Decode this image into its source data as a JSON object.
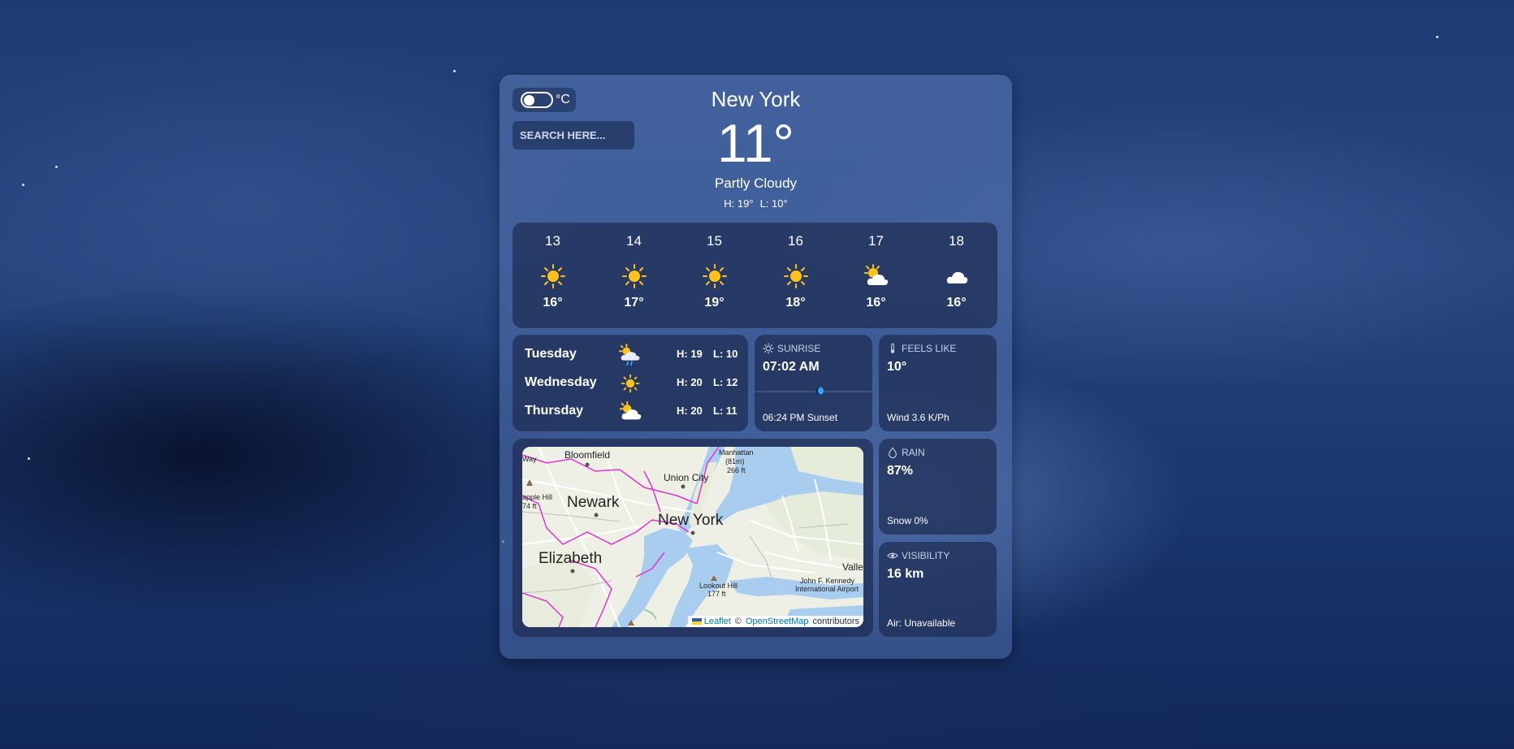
{
  "unit_toggle": {
    "unit": "°C",
    "enabled": false
  },
  "search": {
    "placeholder": "SEARCH HERE..."
  },
  "current": {
    "city": "New York",
    "temp": "11°",
    "condition": "Partly Cloudy",
    "high": "H: 19°",
    "low": "L: 10°"
  },
  "hourly": [
    {
      "label": "13",
      "icon": "sun-icon",
      "temp": "16°"
    },
    {
      "label": "14",
      "icon": "sun-icon",
      "temp": "17°"
    },
    {
      "label": "15",
      "icon": "sun-icon",
      "temp": "19°"
    },
    {
      "label": "16",
      "icon": "sun-icon",
      "temp": "18°"
    },
    {
      "label": "17",
      "icon": "partly-cloudy-icon",
      "temp": "16°"
    },
    {
      "label": "18",
      "icon": "cloud-icon",
      "temp": "16°"
    }
  ],
  "daily": [
    {
      "day": "Tuesday",
      "icon": "rain-cloud-sun-icon",
      "high": "H: 19",
      "low": "L: 10"
    },
    {
      "day": "Wednesday",
      "icon": "sun-icon",
      "high": "H: 20",
      "low": "L: 12"
    },
    {
      "day": "Thursday",
      "icon": "partly-cloudy-icon",
      "high": "H: 20",
      "low": "L: 11"
    }
  ],
  "sunrise": {
    "title": "SUNRISE",
    "value": "07:02 AM",
    "sunset": "06:24 PM Sunset",
    "icon": "sun-outline-icon"
  },
  "feels_like": {
    "title": "FEELS LIKE",
    "value": "10°",
    "wind": "Wind 3.6 K/Ph",
    "icon": "thermometer-icon"
  },
  "rain": {
    "title": "RAIN",
    "value": "87%",
    "snow": "Snow 0%",
    "icon": "droplet-icon"
  },
  "visibility": {
    "title": "VISIBILITY",
    "value": "16 km",
    "air": "Air: Unavailable",
    "icon": "eye-icon"
  },
  "map": {
    "labels": {
      "bloomfield": "Bloomfield",
      "manhattan": "Manhattan",
      "manhattan_sub1": "(81m)",
      "manhattan_sub2": "266 ft",
      "union_city": "Union City",
      "newark": "Newark",
      "new_york": "New York",
      "elizabeth": "Elizabeth",
      "apple_hill": "apple Hill",
      "apple_hill_ft": "74 ft",
      "lookout_hill": "Lookout Hill",
      "lookout_hill_ft": "177 ft",
      "jfk1": "John F. Kennedy",
      "jfk2": "International Airport",
      "valley": "Valle",
      "way": "Way"
    },
    "attribution": {
      "leaflet": "Leaflet",
      "copy": "©",
      "osm": "OpenStreetMap",
      "contributors": "contributors"
    }
  },
  "colors": {
    "accent": "#3aa0ff",
    "sun": "#ffc21a",
    "map_water": "#a9cdee",
    "map_boundary": "#e033d6"
  }
}
